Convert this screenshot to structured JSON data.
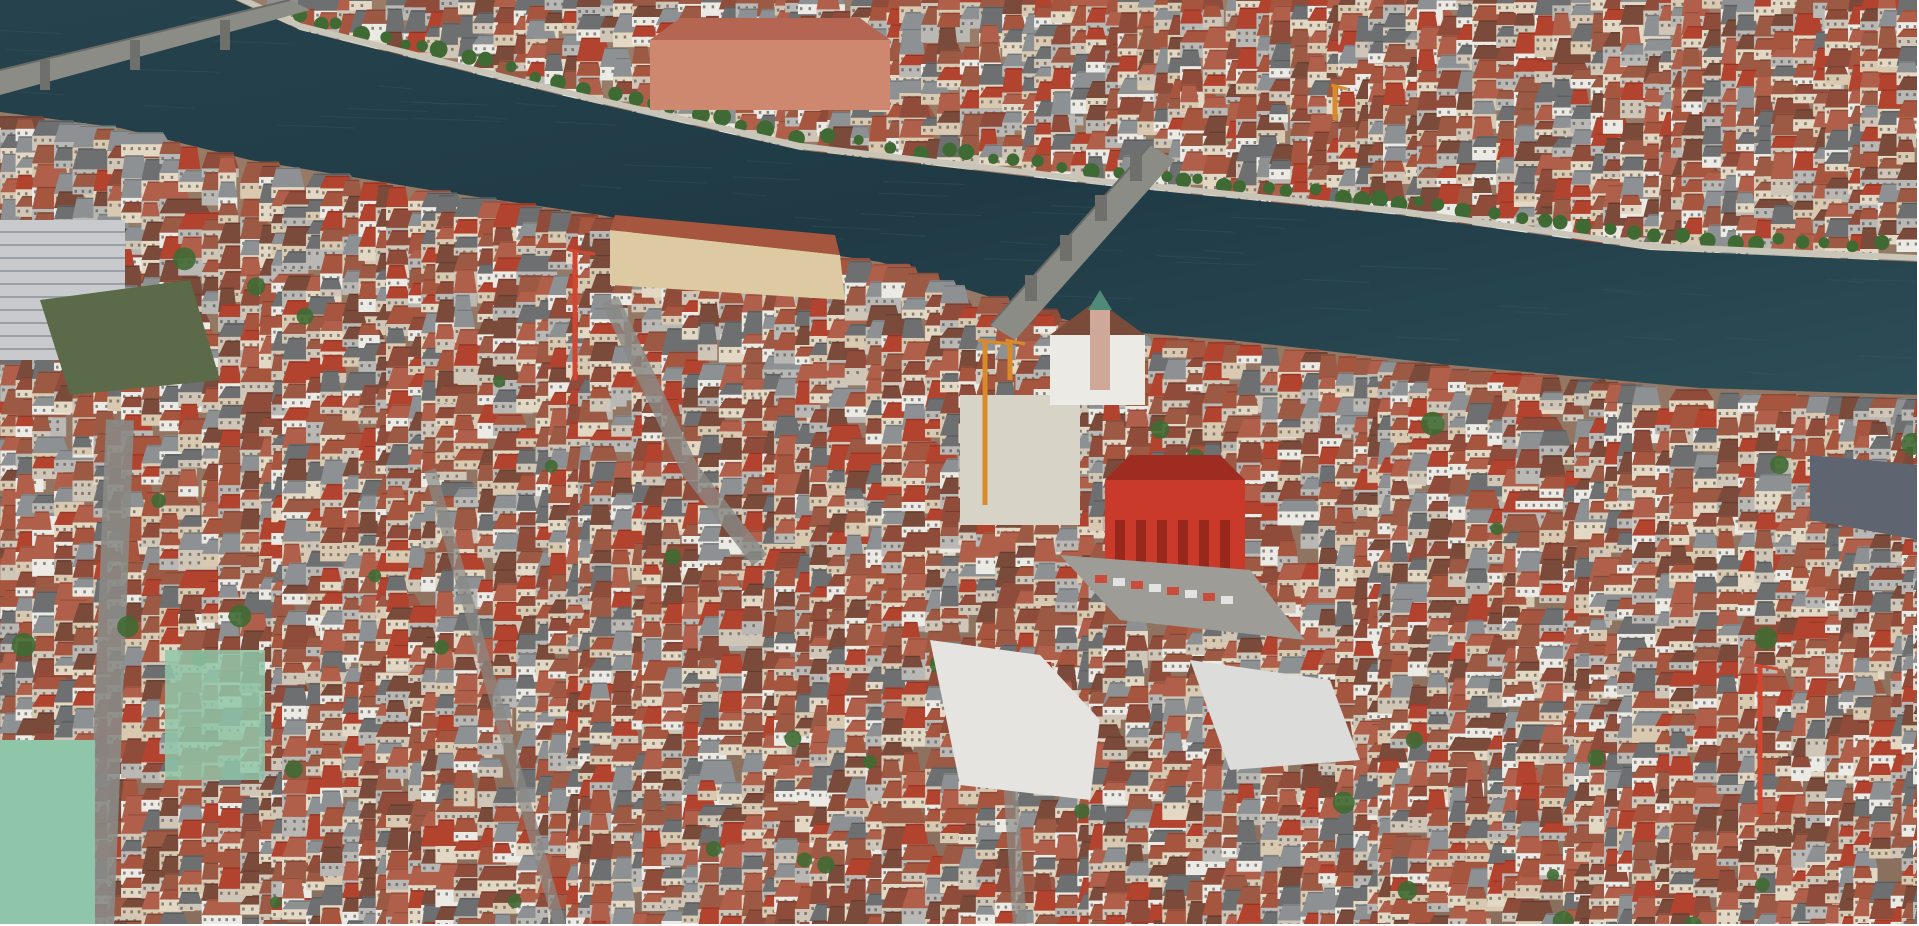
{
  "view": {
    "mode": "3d-aerial-satellite",
    "scene": "river-city-old-town",
    "labels_visible": false
  },
  "colors": {
    "river_dark": "#1f3a44",
    "river_mid": "#2b4953",
    "river_light": "#3a5a62",
    "roof_terracotta": "#a6553f",
    "roof_red": "#b2432f",
    "roof_brown": "#7a4a3a",
    "wall_cream": "#e3d8c4",
    "wall_white": "#eceae5",
    "wall_grey": "#b9b8b4",
    "flat_roof_grey": "#8e9193",
    "flat_roof_green": "#5b6a48",
    "pale_green_roof": "#8fc5a8",
    "town_hall_red": "#c93a2b",
    "tree_green": "#3f6a33",
    "bridge_grey": "#8c8c86",
    "street_grey": "#8a8a86",
    "crane_orange": "#d98a2a",
    "crane_red": "#d2452e",
    "margin_white": "#ffffff"
  },
  "features": [
    {
      "name": "river",
      "kind": "water"
    },
    {
      "name": "bridge-upper-left",
      "kind": "bridge"
    },
    {
      "name": "bridge-center",
      "kind": "bridge"
    },
    {
      "name": "north-bank-district",
      "kind": "buildings"
    },
    {
      "name": "old-town-district",
      "kind": "buildings"
    },
    {
      "name": "town-hall",
      "kind": "landmark"
    },
    {
      "name": "construction-cranes",
      "kind": "structures"
    }
  ]
}
